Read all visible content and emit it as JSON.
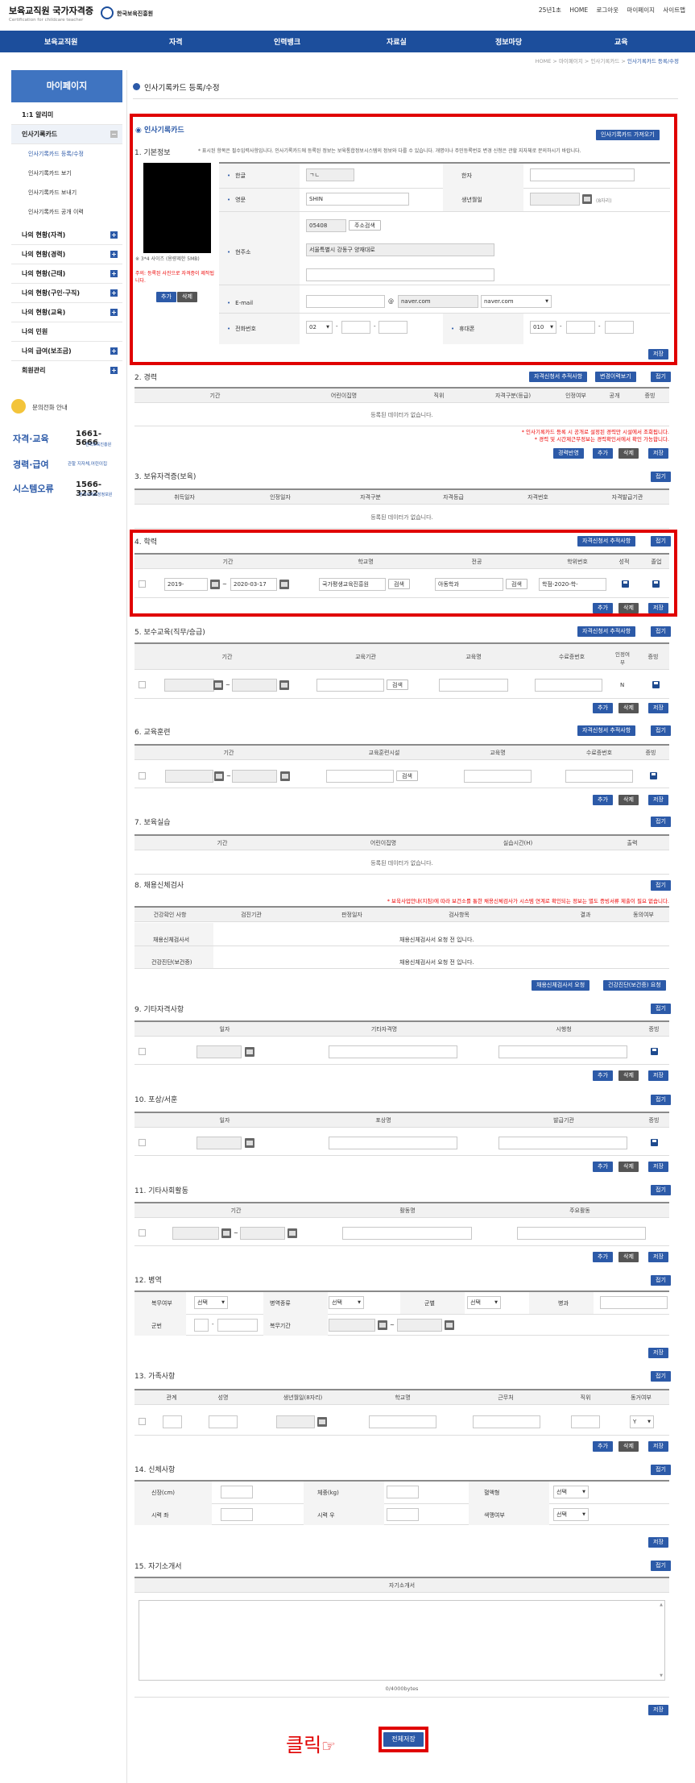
{
  "header": {
    "logo_main": "보육교직원 국가자격증",
    "logo_sub": "Certification for childcare teacher",
    "org_name": "한국보육진흥원",
    "util_links": [
      "25년1초",
      "HOME",
      "로그아웃",
      "마이페이지",
      "사이트맵"
    ]
  },
  "nav": {
    "items": [
      "보육교직원",
      "자격",
      "인력뱅크",
      "자료실",
      "정보마당",
      "교육"
    ]
  },
  "breadcrumb": {
    "items": [
      "HOME",
      "마이페이지",
      "인사기록카드",
      "인사기록카드 등록/수정"
    ]
  },
  "sidebar": {
    "title": "마이페이지",
    "items": [
      {
        "label": "1:1 알리미",
        "type": "item"
      },
      {
        "label": "인사기록카드",
        "type": "active"
      },
      {
        "label": "인사기록카드 등록/수정",
        "type": "sub"
      },
      {
        "label": "인사기록카드 보기",
        "type": "sub"
      },
      {
        "label": "인사기록카드 보내기",
        "type": "sub"
      },
      {
        "label": "인사기록카드 공개 이력",
        "type": "sub"
      },
      {
        "label": "나의 현황(자격)",
        "type": "plus"
      },
      {
        "label": "나의 현황(경력)",
        "type": "plus"
      },
      {
        "label": "나의 현황(근태)",
        "type": "plus"
      },
      {
        "label": "나의 현황(구인·구직)",
        "type": "plus"
      },
      {
        "label": "나의 현황(교육)",
        "type": "plus"
      },
      {
        "label": "나의 민원",
        "type": "item"
      },
      {
        "label": "나의 급여(보조금)",
        "type": "plus"
      },
      {
        "label": "회원관리",
        "type": "plus"
      }
    ],
    "contact_title": "문의전화 안내",
    "contacts": [
      {
        "category": "자격·교육",
        "phone": "1661-5666",
        "org": "한국보육진흥원"
      },
      {
        "category": "경력·급여",
        "phone": "관할 지자체,어린이집",
        "org": ""
      },
      {
        "category": "시스템오류",
        "phone": "1566-3232",
        "org": "한국사회보장정보원"
      }
    ]
  },
  "page": {
    "title": "인사기록카드 등록/수정",
    "card_title": "인사기록카드",
    "preview_btn": "인사기록카드 가져오기"
  },
  "s1": {
    "title": "1. 기본정보",
    "note": "* 표시된 항목은 필수입력사항입니다. 인사기록카드에 등록된 정보는 보육통합정보시스템의 정보와 다를 수 있습니다. 개명이나 주민등록번호 변경 신청은 관할 지자체로 문의하시기 바랍니다.",
    "photo_note": "※ 3*4 사이즈 (용량제한 5MB)",
    "photo_warn": "주의: 등록된 사진으로 자격증이 제작됩니다.",
    "photo_add": "추가",
    "photo_del": "삭제",
    "f_name": "한글",
    "v_name": "ㄱㄴ",
    "f_hanja": "한자",
    "f_eng": "영문",
    "v_eng": "SHIN",
    "f_birth": "생년월일",
    "birth_hint": "(8자리)",
    "f_addr": "현주소",
    "v_zip": "05408",
    "btn_zip": "주소검색",
    "v_addr1": "서울특별시 강동구 양재대로",
    "f_email": "E-mail",
    "email_at": "@",
    "v_email_domain": "naver.com",
    "v_email_sel": "naver.com",
    "f_phone": "전화번호",
    "v_phone_sel": "02",
    "phone_dash": "-",
    "f_mobile": "휴대폰",
    "v_mobile_sel": "010",
    "save": "저장"
  },
  "s2": {
    "title": "2. 경력",
    "btn1": "자격신청서 추적사항",
    "btn2": "변경이력보기",
    "btn_fold": "접기",
    "headers": [
      "기간",
      "어린이집명",
      "직위",
      "자격구분(등급)",
      "인정여부",
      "공개",
      "증빙"
    ],
    "nodata": "등록된 데이터가 없습니다.",
    "note1": "* 인사기록카드 등록 시 공개로 설정된 경력만 시설에서 조회됩니다.",
    "note2": "* 경력 및 시간제근무정보는 경력확인서에서 확인 가능합니다.",
    "btn_career": "경력반영",
    "add": "추가",
    "del": "삭제",
    "save": "저장"
  },
  "s3": {
    "title": "3. 보유자격증(보육)",
    "btn_fold": "접기",
    "headers": [
      "취득일자",
      "인정일자",
      "자격구분",
      "자격등급",
      "자격번호",
      "자격발급기관"
    ],
    "nodata": "등록된 데이터가 없습니다."
  },
  "s4": {
    "title": "4. 학력",
    "btn1": "자격신청서 추적사항",
    "btn_fold": "접기",
    "headers": [
      "기간",
      "학교명",
      "전공",
      "학위번호",
      "성적",
      "졸업"
    ],
    "v_from": "2019-",
    "v_to": "2020-03-17",
    "v_school": "국가평생교육진흥원",
    "btn_search": "검색",
    "v_major": "아동학과",
    "v_degree": "학점-2020-학-",
    "add": "추가",
    "del": "삭제",
    "save": "저장"
  },
  "s5": {
    "title": "5. 보수교육(직무/승급)",
    "btn1": "자격신청서 추적사항",
    "btn_fold": "접기",
    "headers": [
      "기간",
      "교육기관",
      "교육명",
      "수료증번호",
      "인정여부",
      "증빙"
    ],
    "btn_search": "검색",
    "v_recog": "N",
    "add": "추가",
    "del": "삭제",
    "save": "저장"
  },
  "s6": {
    "title": "6. 교육훈련",
    "btn1": "자격신청서 추적사항",
    "btn_fold": "접기",
    "headers": [
      "기간",
      "교육훈련시설",
      "교육명",
      "수료증번호",
      "증빙"
    ],
    "btn_search": "검색",
    "add": "추가",
    "del": "삭제",
    "save": "저장"
  },
  "s7": {
    "title": "7. 보육실습",
    "btn_fold": "접기",
    "headers": [
      "기간",
      "어린이집명",
      "실습시간(H)",
      "출력"
    ],
    "nodata": "등록된 데이터가 없습니다."
  },
  "s8": {
    "title": "8. 채용신체검사",
    "btn_fold": "접기",
    "note": "* 보육사업안내(지침)에 따라 보건소를 통한 채용신체검사가 시스템 연계로 확인되는 정보는 별도 증빙서류 제출이 필요 없습니다.",
    "headers": [
      "건강확인 사항",
      "검진기관",
      "판정일자",
      "검사항목",
      "결과",
      "동의여부"
    ],
    "rows": [
      {
        "label": "채용신체검사서",
        "msg": "채용신체검사서 요청 전 입니다."
      },
      {
        "label": "건강진단(보건증)",
        "msg": "채용신체검사서 요청 전 입니다."
      }
    ],
    "btn1": "채용신체검사서 요청",
    "btn2": "건강진단(보건증) 요청"
  },
  "s9": {
    "title": "9. 기타자격사항",
    "btn_fold": "접기",
    "headers": [
      "일자",
      "기타자격명",
      "시행청",
      "증빙"
    ],
    "add": "추가",
    "del": "삭제",
    "save": "저장"
  },
  "s10": {
    "title": "10. 포상/서훈",
    "btn_fold": "접기",
    "headers": [
      "일자",
      "포상명",
      "발급기관",
      "증빙"
    ],
    "add": "추가",
    "del": "삭제",
    "save": "저장"
  },
  "s11": {
    "title": "11. 기타사회활동",
    "btn_fold": "접기",
    "headers": [
      "기간",
      "활동명",
      "주요활동"
    ],
    "add": "추가",
    "del": "삭제",
    "save": "저장"
  },
  "s12": {
    "title": "12. 병역",
    "btn_fold": "접기",
    "f_status": "복무여부",
    "f_type": "병역종류",
    "f_branch": "군별",
    "f_rank": "병과",
    "f_num": "군번",
    "f_period": "복무기간",
    "sel": "선택",
    "save": "저장"
  },
  "s13": {
    "title": "13. 가족사항",
    "btn_fold": "접기",
    "headers": [
      "관계",
      "성명",
      "생년월일(8자리)",
      "학교명",
      "근무처",
      "직위",
      "동거여부"
    ],
    "v_live": "Y",
    "add": "추가",
    "del": "삭제",
    "save": "저장"
  },
  "s14": {
    "title": "14. 신체사항",
    "btn_fold": "접기",
    "f_height": "신장(cm)",
    "f_weight": "체중(kg)",
    "f_blood": "혈액형",
    "f_eye_l": "시력 좌",
    "f_eye_r": "시력 우",
    "f_color": "색맹여부",
    "sel": "선택",
    "save": "저장"
  },
  "s15": {
    "title": "15. 자기소개서",
    "btn_fold": "접기",
    "header": "자기소개서",
    "counter": "0/4000bytes",
    "save": "저장"
  },
  "footer": {
    "click_label": "클릭",
    "click_icon": "☞",
    "save_all": "전체저장"
  },
  "colors": {
    "nav": "#1c4e9c",
    "accent": "#2c5aa8",
    "highlight": "#e00000"
  }
}
